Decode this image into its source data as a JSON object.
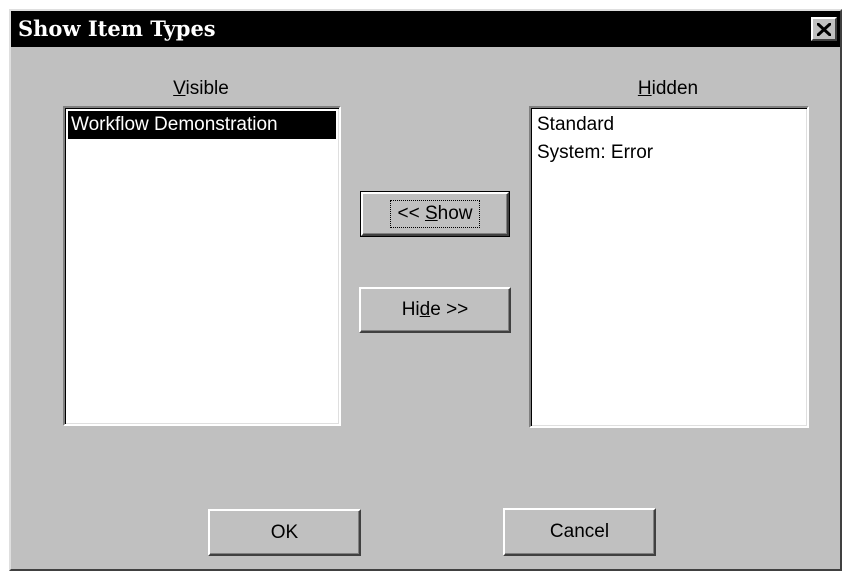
{
  "window": {
    "title": "Show Item Types",
    "close_glyph": "close-icon"
  },
  "visible_list": {
    "label_mnemonic": "V",
    "label_rest": "isible",
    "items": [
      {
        "text": "Workflow Demonstration",
        "selected": true
      }
    ]
  },
  "hidden_list": {
    "label_mnemonic": "H",
    "label_rest": "idden",
    "items": [
      {
        "text": "Standard",
        "selected": false
      },
      {
        "text": "System: Error",
        "selected": false
      }
    ]
  },
  "buttons": {
    "show": {
      "prefix": "<< ",
      "mnemonic": "S",
      "rest": "how"
    },
    "hide": {
      "prefix": "Hi",
      "mnemonic": "d",
      "rest": "e >>"
    },
    "ok": {
      "label": "OK"
    },
    "cancel": {
      "label": "Cancel"
    }
  },
  "colors": {
    "titlebar": "#000000",
    "face": "#c0c0c0",
    "selection": "#000000"
  }
}
